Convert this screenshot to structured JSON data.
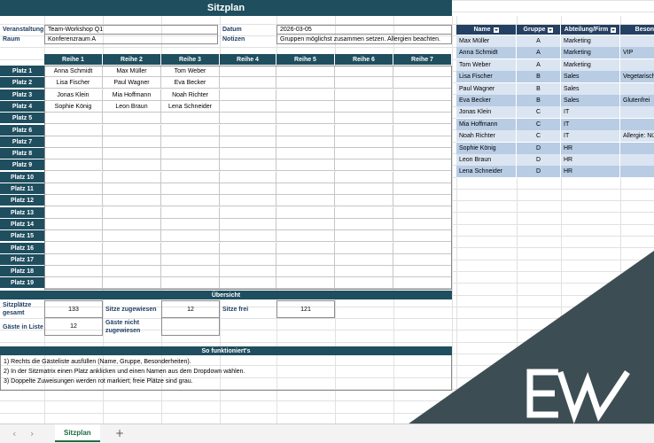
{
  "sheet": {
    "title": "Sitzplan",
    "meta": {
      "veranstaltung_label": "Veranstaltung",
      "veranstaltung_value": "Team-Workshop Q1",
      "raum_label": "Raum",
      "raum_value": "Konferenzraum A",
      "datum_label": "Datum",
      "datum_value": "2026-03-05",
      "notizen_label": "Notizen",
      "notizen_value": "Gruppen möglichst zusammen setzen. Allergien beachten."
    },
    "rows": [
      "Reihe 1",
      "Reihe 2",
      "Reihe 3",
      "Reihe 4",
      "Reihe 5",
      "Reihe 6",
      "Reihe 7"
    ],
    "seats": [
      "Platz 1",
      "Platz 2",
      "Platz 3",
      "Platz 4",
      "Platz 5",
      "Platz 6",
      "Platz 7",
      "Platz 8",
      "Platz 9",
      "Platz 10",
      "Platz 11",
      "Platz 12",
      "Platz 13",
      "Platz 14",
      "Platz 15",
      "Platz 16",
      "Platz 17",
      "Platz 18",
      "Platz 19"
    ],
    "assignments": [
      [
        "Anna Schmidt",
        "Max Müller",
        "Tom Weber"
      ],
      [
        "Lisa Fischer",
        "Paul Wagner",
        "Eva Becker"
      ],
      [
        "Jonas Klein",
        "Mia Hoffmann",
        "Noah Richter"
      ],
      [
        "Sophie König",
        "Leon Braun",
        "Lena Schneider"
      ]
    ],
    "overview": {
      "header": "Übersicht",
      "total_label_1": "Sitzplätze",
      "total_label_2": "gesamt",
      "total_value": "133",
      "assigned_label": "Sitze zugewiesen",
      "assigned_value": "12",
      "free_label": "Sitze frei",
      "free_value": "121",
      "guests_label": "Gäste in Liste",
      "guests_value": "12",
      "unassigned_label_1": "Gäste nicht",
      "unassigned_label_2": "zugewiesen",
      "unassigned_value": ""
    },
    "howto": {
      "header": "So funktioniert's",
      "steps": [
        "1) Rechts die Gästeliste ausfüllen (Name, Gruppe, Besonderheiten).",
        "2) In der Sitzmatrix einen Platz anklicken und einen Namen aus dem Dropdown wählen.",
        "3) Doppelte Zuweisungen werden rot markiert; freie Plätze sind grau."
      ]
    }
  },
  "guest_table": {
    "headers": [
      "Name",
      "Gruppe",
      "Abteilung/Firm",
      "Besond"
    ],
    "rows": [
      [
        "Max Müller",
        "A",
        "Marketing",
        ""
      ],
      [
        "Anna Schmidt",
        "A",
        "Marketing",
        "VIP"
      ],
      [
        "Tom Weber",
        "A",
        "Marketing",
        ""
      ],
      [
        "Lisa Fischer",
        "B",
        "Sales",
        "Vegetarisch"
      ],
      [
        "Paul Wagner",
        "B",
        "Sales",
        ""
      ],
      [
        "Eva Becker",
        "B",
        "Sales",
        "Glutenfrei"
      ],
      [
        "Jonas Klein",
        "C",
        "IT",
        ""
      ],
      [
        "Mia Hoffmann",
        "C",
        "IT",
        ""
      ],
      [
        "Noah Richter",
        "C",
        "IT",
        "Allergie: Nü"
      ],
      [
        "Sophie König",
        "D",
        "HR",
        ""
      ],
      [
        "Leon Braun",
        "D",
        "HR",
        ""
      ],
      [
        "Lena Schneider",
        "D",
        "HR",
        ""
      ]
    ]
  },
  "tabs": {
    "active": "Sitzplan",
    "add": "+",
    "prev": "‹",
    "next": "›"
  },
  "colors": {
    "header_navy": "#1f4e5f",
    "label_blue": "#1f3f66",
    "table_header": "#244062",
    "band_light": "#dbe5f1",
    "band_dark": "#b8cce4",
    "deco_gray": "#3d4d54",
    "tab_green": "#1e6c3f"
  },
  "icons": {
    "logo": "ex-logo-icon",
    "filter": "filter-dropdown-icon"
  }
}
